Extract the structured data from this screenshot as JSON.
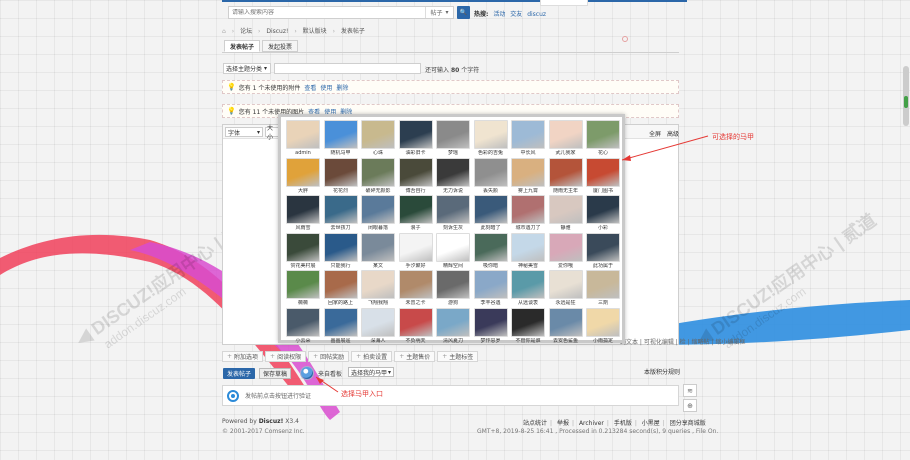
{
  "search": {
    "placeholder": "请输入搜索内容",
    "type_label": "帖子",
    "type_arrow": "▾",
    "button_icon": "🔍",
    "hot_label": "热搜:",
    "hot_items": [
      "活动",
      "交友",
      "discuz"
    ]
  },
  "breadcrumb": {
    "home_icon": "⌂",
    "items": [
      "论坛",
      "Discuz!",
      "默认版块",
      "发表帖子"
    ],
    "sep": "›"
  },
  "tabs": [
    "发表帖子",
    "发起投票"
  ],
  "form": {
    "category_label": "选择主题分类",
    "category_arrow": "▾",
    "title_hint_prefix": "还可输入",
    "title_hint_count": "80",
    "title_hint_suffix": "个字符"
  },
  "notices": [
    {
      "text": "您有 1 个未使用的附件",
      "links": [
        "查看",
        "使用",
        "删除"
      ]
    },
    {
      "text": "您有 11 个未使用的图片",
      "links": [
        "查看",
        "使用",
        "删除"
      ]
    }
  ],
  "editor": {
    "font_label": "字体",
    "size_label": "大小",
    "select_arrow": "▾",
    "right_tools": [
      "全屏",
      "高级"
    ],
    "footer": "纯文本 | 可视化编辑 | 检 | 缩略帖 | 缩小编辑框"
  },
  "extras": [
    "附加选项",
    "阅读权限",
    "回帖奖励",
    "拍卖设置",
    "主题售价",
    "主题标签"
  ],
  "extras_icon": "+",
  "rules_link": "本版积分规则",
  "actions": {
    "post": "发表帖子",
    "save": "保存草稿",
    "mask_label": "来自看板",
    "mask_select": "选择我的马甲"
  },
  "verify_text": "发帖前点击按钮进行验证",
  "side_buttons": [
    "≋",
    "⊕"
  ],
  "footer": {
    "powered_prefix": "Powered by",
    "powered_name": "Discuz!",
    "powered_version": "X3.4",
    "copyright": "© 2001-2017 Comsenz Inc.",
    "links": [
      "站点统计",
      "举报",
      "Archiver",
      "手机版",
      "小黑屋",
      "团分享商城版"
    ],
    "gmt": "GMT+8, 2019-8-25 16:41 , Processed in 0.213284 second(s), 9 queries , File On."
  },
  "annotations": {
    "selectable_mask": "可选择的马甲",
    "mask_entry": "选择马甲入口"
  },
  "colors": {
    "brand_blue": "#2b67a9",
    "annotation_red": "#e53935",
    "ribbon_red": "#f0405a",
    "ribbon_magenta": "#d84ccf",
    "ribbon_blue": "#2e8ee0"
  },
  "avatars": [
    {
      "name": "admin",
      "color": "#e9d3b8"
    },
    {
      "name": "随机马甲",
      "color": "#4a90d9"
    },
    {
      "name": "心珠",
      "color": "#c8b98e"
    },
    {
      "name": "油彩旧卡",
      "color": "#2c3e50"
    },
    {
      "name": "梦瑶",
      "color": "#8a8a8a"
    },
    {
      "name": "色彩的吉兔",
      "color": "#f0e4d0"
    },
    {
      "name": "中长风",
      "color": "#9dbad6"
    },
    {
      "name": "武儿我家",
      "color": "#f1d4c4"
    },
    {
      "name": "花心",
      "color": "#7d9b6a"
    },
    {
      "name": "大胖",
      "color": "#e0a23a"
    },
    {
      "name": "花花烈",
      "color": "#6b4a3a"
    },
    {
      "name": "破碎无颜影",
      "color": "#6b7b5a"
    },
    {
      "name": "博吾自行",
      "color": "#4a4a3a"
    },
    {
      "name": "无力诉说",
      "color": "#3a3a3a"
    },
    {
      "name": "丢失颜",
      "color": "#8f8f8f"
    },
    {
      "name": "雾上九霄",
      "color": "#d9b080"
    },
    {
      "name": "随雨无主年",
      "color": "#b4543a"
    },
    {
      "name": "厦门图书",
      "color": "#c74a32"
    },
    {
      "name": "风雨雪",
      "color": "#2a3540"
    },
    {
      "name": "去世孩刀",
      "color": "#3a6a8a"
    },
    {
      "name": "闭眼暮落",
      "color": "#5a7a9a"
    },
    {
      "name": "浪子",
      "color": "#2a4a3a"
    },
    {
      "name": "刻诉生灰",
      "color": "#5a6a7a"
    },
    {
      "name": "此刻暗了",
      "color": "#3a5a7a"
    },
    {
      "name": "城市遇刀了",
      "color": "#b07070"
    },
    {
      "name": "静雅",
      "color": "#d8c8c0"
    },
    {
      "name": "小彩",
      "color": "#2a3a4a"
    },
    {
      "name": "赞花美村展",
      "color": "#3a4a3a"
    },
    {
      "name": "只能我行",
      "color": "#2a5a8a"
    },
    {
      "name": "某文",
      "color": "#7a8a9a"
    },
    {
      "name": "手汐聚好",
      "color": "#f4f4f4"
    },
    {
      "name": "精辉空间",
      "color": "#ffffff"
    },
    {
      "name": "吸你暗",
      "color": "#4a6a5a"
    },
    {
      "name": "神秘美雪",
      "color": "#c4d8e8"
    },
    {
      "name": "爱你哦",
      "color": "#d8a8b8"
    },
    {
      "name": "此功属于",
      "color": "#3a4a5a"
    },
    {
      "name": "薇薇",
      "color": "#5a8a4a"
    },
    {
      "name": "回家的路上",
      "color": "#a86a4a"
    },
    {
      "name": "飞翔我翔",
      "color": "#e8d8c8"
    },
    {
      "name": "未曾之卡",
      "color": "#b08a6a"
    },
    {
      "name": "游狗",
      "color": "#6a6a6a"
    },
    {
      "name": "李丰谷遇",
      "color": "#8aa8c8"
    },
    {
      "name": "从远谈衷",
      "color": "#5a9aa8"
    },
    {
      "name": "永远是狂",
      "color": "#e8e0d4"
    },
    {
      "name": "三劑",
      "color": "#c8b89a"
    },
    {
      "name": "小云朵",
      "color": "#4a5a6a"
    },
    {
      "name": "画画展遥",
      "color": "#3a6a9a"
    },
    {
      "name": "深海人",
      "color": "#d8e0e8"
    },
    {
      "name": "不负明天",
      "color": "#c84a4a"
    },
    {
      "name": "清风夏刀",
      "color": "#7aa8c8"
    },
    {
      "name": "梦作思罗",
      "color": "#3a3a5a"
    },
    {
      "name": "不管你是谁",
      "color": "#2a2a2a"
    },
    {
      "name": "去安色鲨鱼",
      "color": "#6a8aa8"
    },
    {
      "name": "小雨孤定",
      "color": "#f0d8a8"
    }
  ]
}
